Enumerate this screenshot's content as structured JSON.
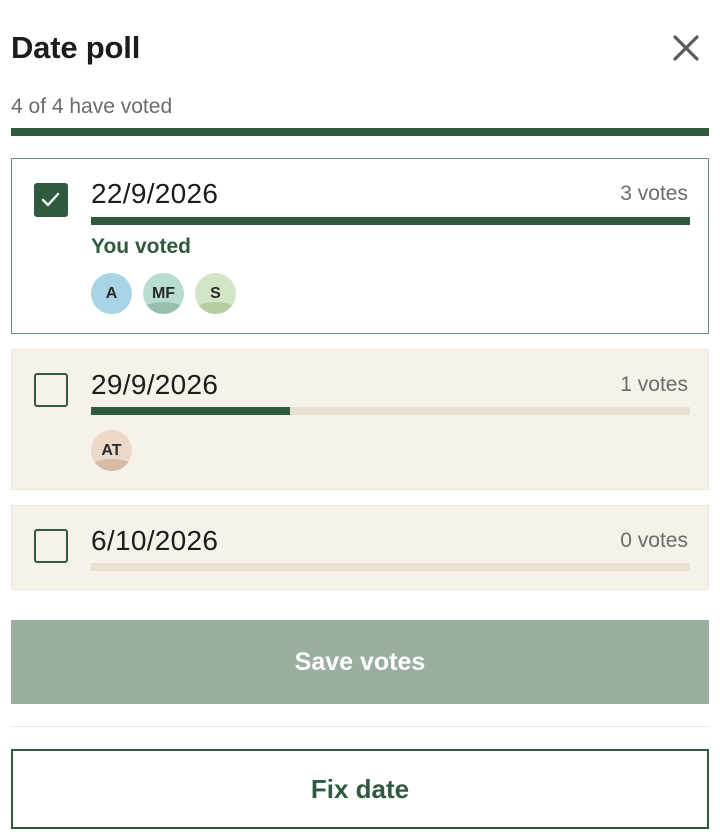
{
  "header": {
    "title": "Date poll",
    "close_icon": "close-icon"
  },
  "summary": {
    "voted_text": "4 of 4 have voted",
    "voted_fraction": 1.0
  },
  "options": [
    {
      "date": "22/9/2026",
      "votes_text": "3 votes",
      "checked": true,
      "fraction": 1.0,
      "you_voted": "You voted",
      "voters": [
        {
          "initials": "A",
          "color": "#a9d4e6",
          "hill": "#a9d4e6"
        },
        {
          "initials": "MF",
          "color": "#b7ddd0",
          "hill": "#98bfae"
        },
        {
          "initials": "S",
          "color": "#d2e6c7",
          "hill": "#b5cfa4"
        }
      ]
    },
    {
      "date": "29/9/2026",
      "votes_text": "1 votes",
      "checked": false,
      "fraction": 0.333,
      "voters": [
        {
          "initials": "AT",
          "color": "#ecd9c9",
          "hill": "#d6bba6"
        }
      ]
    },
    {
      "date": "6/10/2026",
      "votes_text": "0 votes",
      "checked": false,
      "fraction": 0.0,
      "voters": []
    }
  ],
  "actions": {
    "save_label": "Save votes",
    "fix_label": "Fix date"
  },
  "colors": {
    "accent": "#2f5a3e",
    "track": "#e8e1d2",
    "card_bg": "#f6f2ea",
    "save_bg": "#9aaf9f"
  }
}
